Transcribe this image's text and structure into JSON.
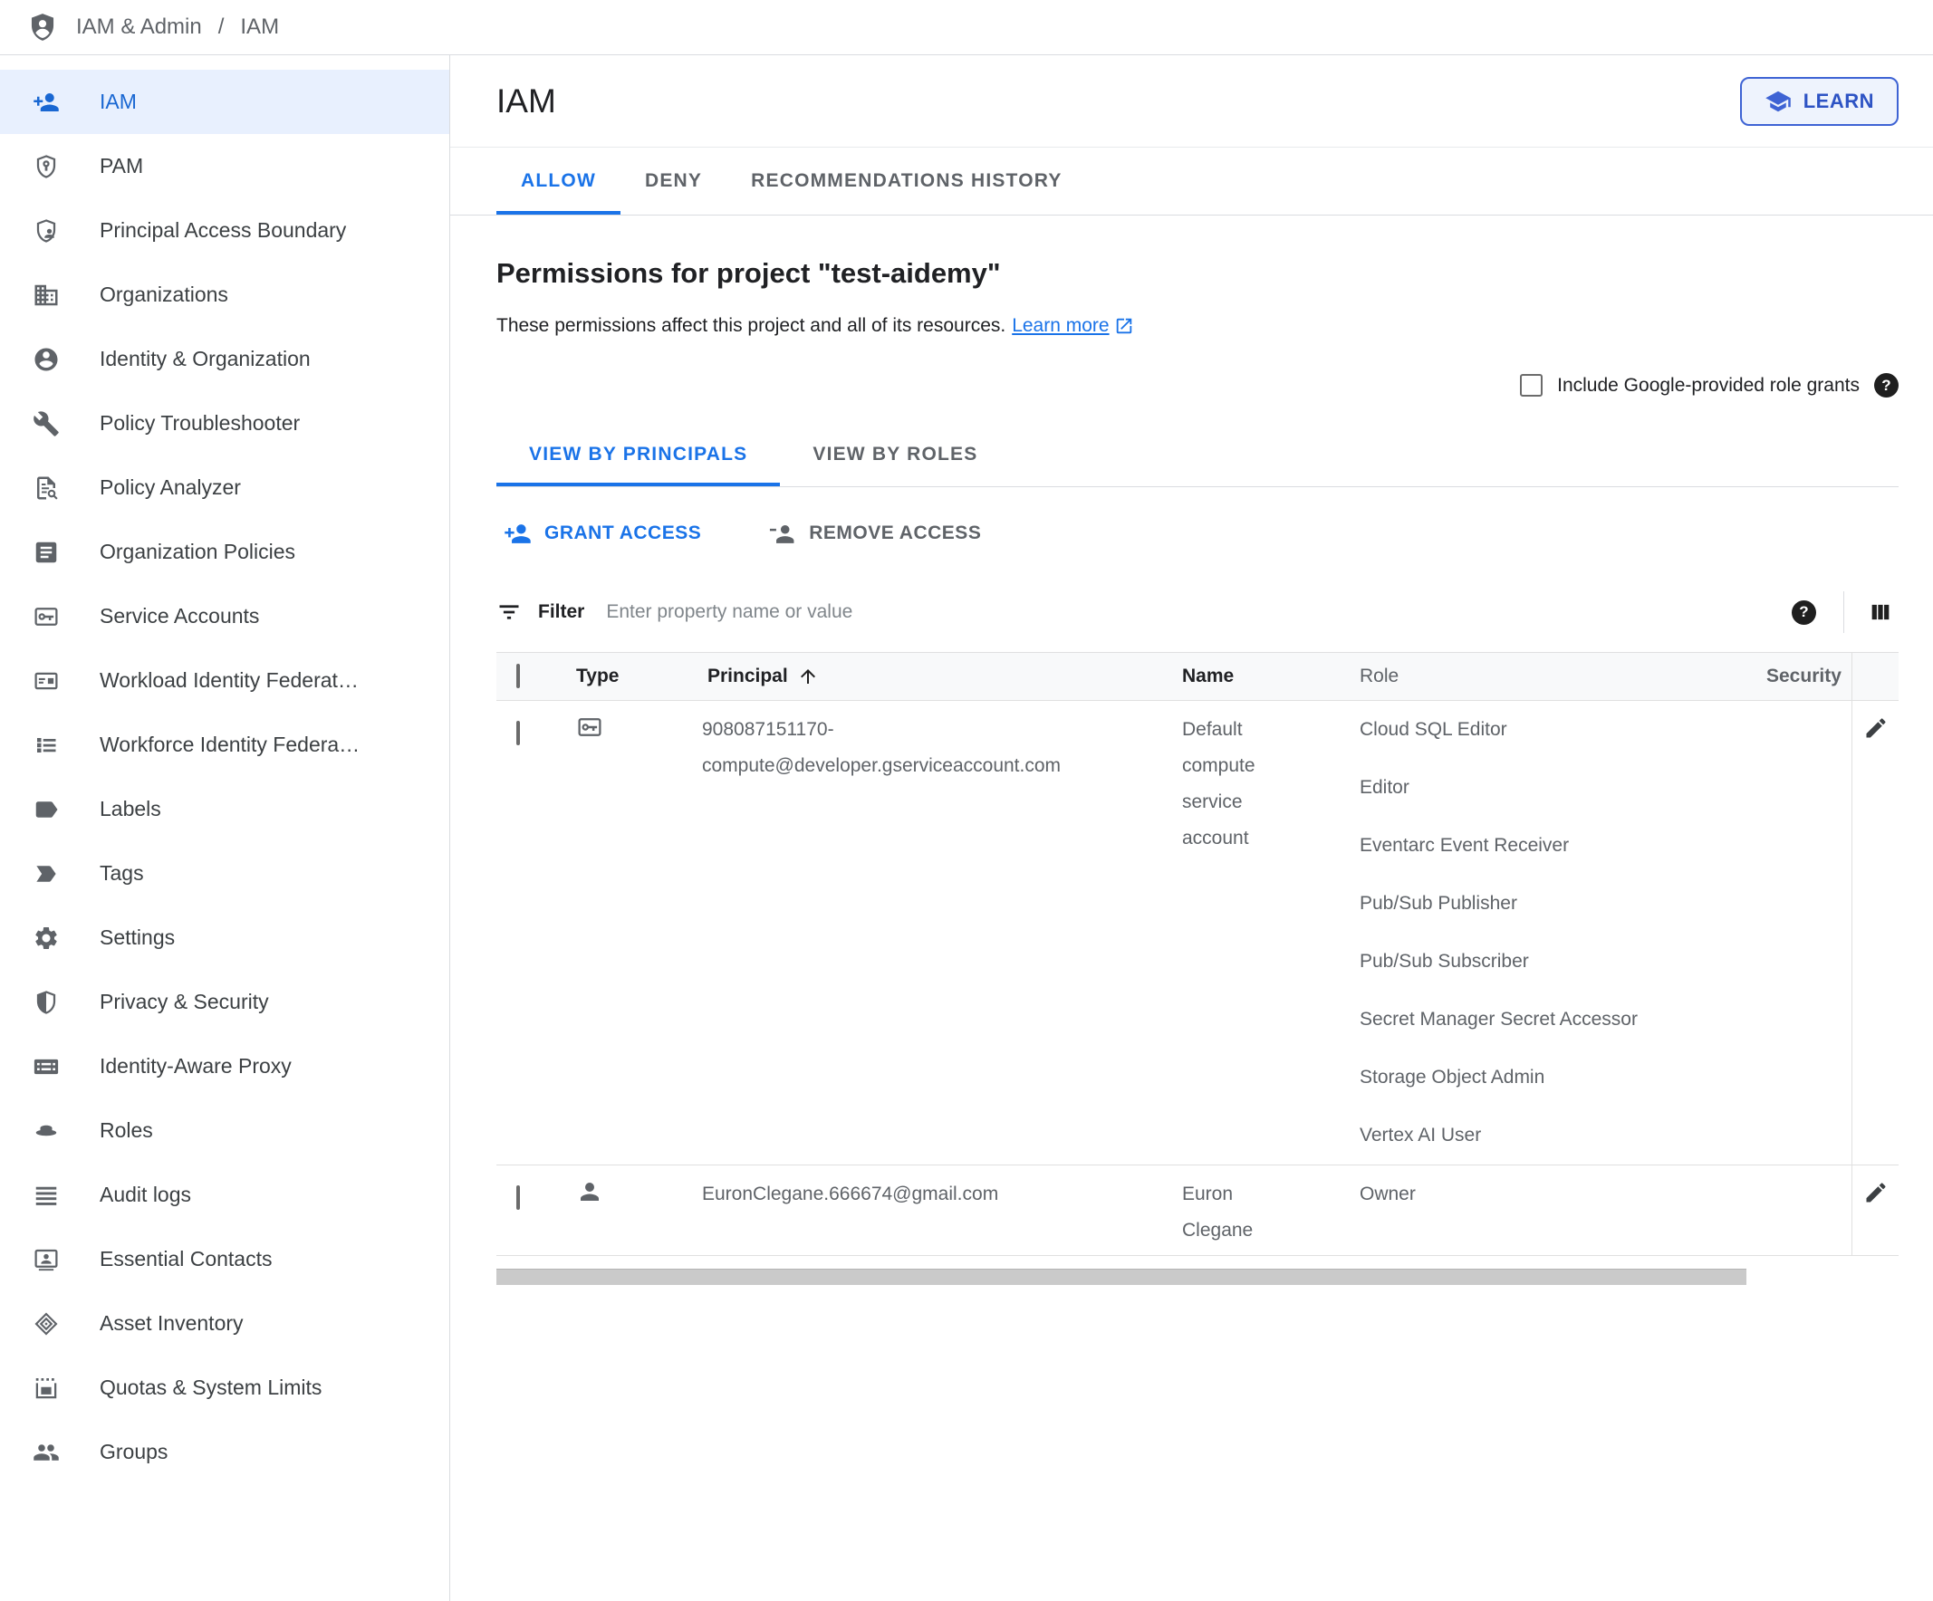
{
  "topbar": {
    "section": "IAM & Admin",
    "separator": "/",
    "page": "IAM"
  },
  "sidebar": {
    "items": [
      {
        "label": "IAM",
        "icon": "person-add",
        "selected": true
      },
      {
        "label": "PAM",
        "icon": "shield-key"
      },
      {
        "label": "Principal Access Boundary",
        "icon": "shield-person"
      },
      {
        "label": "Organizations",
        "icon": "organizations"
      },
      {
        "label": "Identity & Organization",
        "icon": "account-circle"
      },
      {
        "label": "Policy Troubleshooter",
        "icon": "wrench"
      },
      {
        "label": "Policy Analyzer",
        "icon": "doc-search"
      },
      {
        "label": "Organization Policies",
        "icon": "article"
      },
      {
        "label": "Service Accounts",
        "icon": "service-account"
      },
      {
        "label": "Workload Identity Federat…",
        "icon": "badge-card"
      },
      {
        "label": "Workforce Identity Federa…",
        "icon": "list"
      },
      {
        "label": "Labels",
        "icon": "label"
      },
      {
        "label": "Tags",
        "icon": "label-important"
      },
      {
        "label": "Settings",
        "icon": "gear"
      },
      {
        "label": "Privacy & Security",
        "icon": "shield-half"
      },
      {
        "label": "Identity-Aware Proxy",
        "icon": "iap-card"
      },
      {
        "label": "Roles",
        "icon": "hat"
      },
      {
        "label": "Audit logs",
        "icon": "lines"
      },
      {
        "label": "Essential Contacts",
        "icon": "contact-card"
      },
      {
        "label": "Asset Inventory",
        "icon": "nested-diamonds"
      },
      {
        "label": "Quotas & System Limits",
        "icon": "quota-frame"
      },
      {
        "label": "Groups",
        "icon": "groups"
      }
    ]
  },
  "main": {
    "title": "IAM",
    "learn_label": "LEARN",
    "tabs": [
      {
        "label": "ALLOW",
        "active": true
      },
      {
        "label": "DENY",
        "active": false
      },
      {
        "label": "RECOMMENDATIONS HISTORY",
        "active": false
      }
    ],
    "heading": "Permissions for project \"test-aidemy\"",
    "description": "These permissions affect this project and all of its resources.",
    "learn_more_label": "Learn more",
    "include_label": "Include Google-provided role grants",
    "help_glyph": "?",
    "view_tabs": [
      {
        "label": "VIEW BY PRINCIPALS",
        "active": true
      },
      {
        "label": "VIEW BY ROLES",
        "active": false
      }
    ],
    "grant_label": "GRANT ACCESS",
    "remove_label": "REMOVE ACCESS",
    "filter_label": "Filter",
    "filter_placeholder": "Enter property name or value",
    "table": {
      "headers": {
        "type": "Type",
        "principal": "Principal",
        "name": "Name",
        "role": "Role",
        "security": "Security"
      },
      "rows": [
        {
          "type_icon": "service-account",
          "principal": "908087151170-compute@developer.gserviceaccount.com",
          "name": "Default compute service account",
          "roles": [
            "Cloud SQL Editor",
            "Editor",
            "Eventarc Event Receiver",
            "Pub/Sub Publisher",
            "Pub/Sub Subscriber",
            "Secret Manager Secret Accessor",
            "Storage Object Admin",
            "Vertex AI User"
          ]
        },
        {
          "type_icon": "person",
          "principal": "EuronClegane.666674@gmail.com",
          "name": "Euron Clegane",
          "roles": [
            "Owner"
          ]
        }
      ]
    },
    "colors": {
      "accent_blue": "#1a73e8",
      "sidebar_selected_bg": "#e8f0fe",
      "sidebar_selected_text": "#1967d2",
      "learn_button_blue": "#3e63d4",
      "secondary_text": "#5f6368",
      "table_header_bg": "#f8f9fa"
    }
  }
}
